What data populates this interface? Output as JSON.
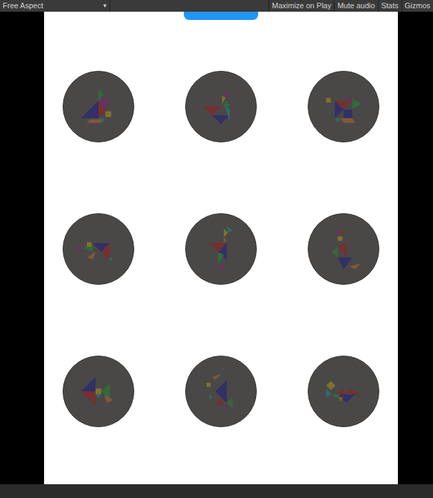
{
  "toolbar": {
    "aspect": "Free Aspect",
    "aspect_arrow": "▾",
    "buttons": [
      {
        "label": "Maximize on Play",
        "selected": false
      },
      {
        "label": "Mute audio",
        "selected": false
      },
      {
        "label": "Stats",
        "selected": false
      },
      {
        "label": "Gizmos",
        "selected": false
      }
    ]
  },
  "levels": [
    {
      "locked": true
    },
    {
      "locked": true
    },
    {
      "locked": true
    },
    {
      "locked": true
    },
    {
      "locked": true
    },
    {
      "locked": true
    },
    {
      "locked": true
    },
    {
      "locked": true
    },
    {
      "locked": true
    }
  ]
}
